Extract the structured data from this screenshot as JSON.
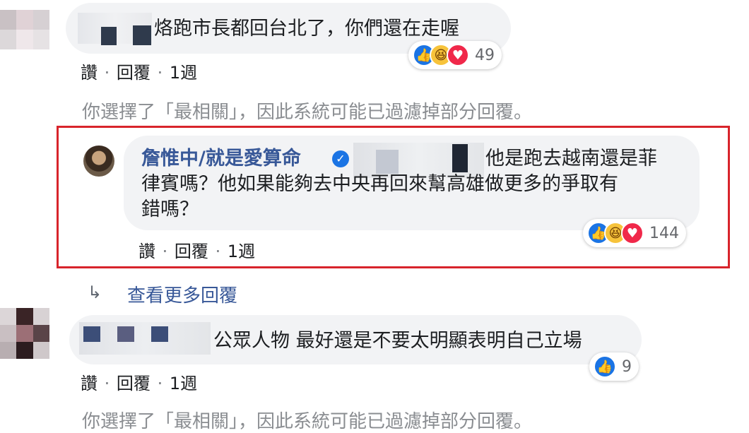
{
  "comments": [
    {
      "text": "烙跑市長都回台北了，你們還在走喔",
      "meta": {
        "like": "讚",
        "reply": "回覆",
        "time": "1週"
      },
      "reaction_count": "49"
    },
    {
      "author": "詹惟中/就是愛算命",
      "text_line1": "他是跑去越南還是菲",
      "text_line2": "律賓嗎？他如果能夠去中央再回來幫高雄做更多的爭取有",
      "text_line3": "錯嗎？",
      "meta": {
        "like": "讚",
        "reply": "回覆",
        "time": "1週"
      },
      "reaction_count": "144"
    },
    {
      "text": "公眾人物 最好還是不要太明顯表明自己立場",
      "meta": {
        "like": "讚",
        "reply": "回覆",
        "time": "1週"
      },
      "reaction_count": "9"
    }
  ],
  "filter_notice": "你選擇了「最相關」，因此系統可能已過濾掉部分回覆。",
  "view_more": "查看更多回覆",
  "dot": "·",
  "icons": {
    "reply_arrow": "reply-arrow-icon",
    "verified": "verified-badge-icon",
    "like": "like-reaction-icon",
    "haha": "haha-reaction-icon",
    "love": "love-reaction-icon"
  },
  "colors": {
    "highlight_border": "#d8242b",
    "like_blue": "#1b74e4",
    "love_red": "#f0284a"
  }
}
